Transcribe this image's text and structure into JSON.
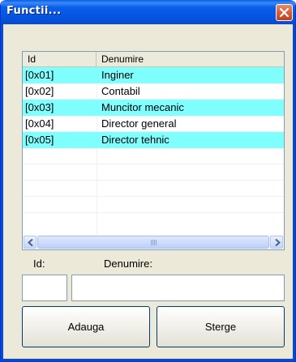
{
  "window": {
    "title": "Functii..."
  },
  "list": {
    "columns": [
      "Id",
      "Denumire"
    ],
    "rows": [
      {
        "id": "[0x01]",
        "name": "Inginer",
        "selected": true
      },
      {
        "id": "[0x02]",
        "name": "Contabil",
        "selected": false
      },
      {
        "id": "[0x03]",
        "name": "Muncitor mecanic",
        "selected": true
      },
      {
        "id": "[0x04]",
        "name": "Director general",
        "selected": false
      },
      {
        "id": "[0x05]",
        "name": "Director tehnic",
        "selected": true
      }
    ],
    "empty_rows": 4
  },
  "form": {
    "id_label": "Id:",
    "name_label": "Denumire:",
    "id_value": "",
    "name_value": ""
  },
  "buttons": {
    "add": "Adauga",
    "delete": "Sterge"
  },
  "colors": {
    "selection": "#80ffff",
    "titlebar": "#0a5ee8"
  }
}
